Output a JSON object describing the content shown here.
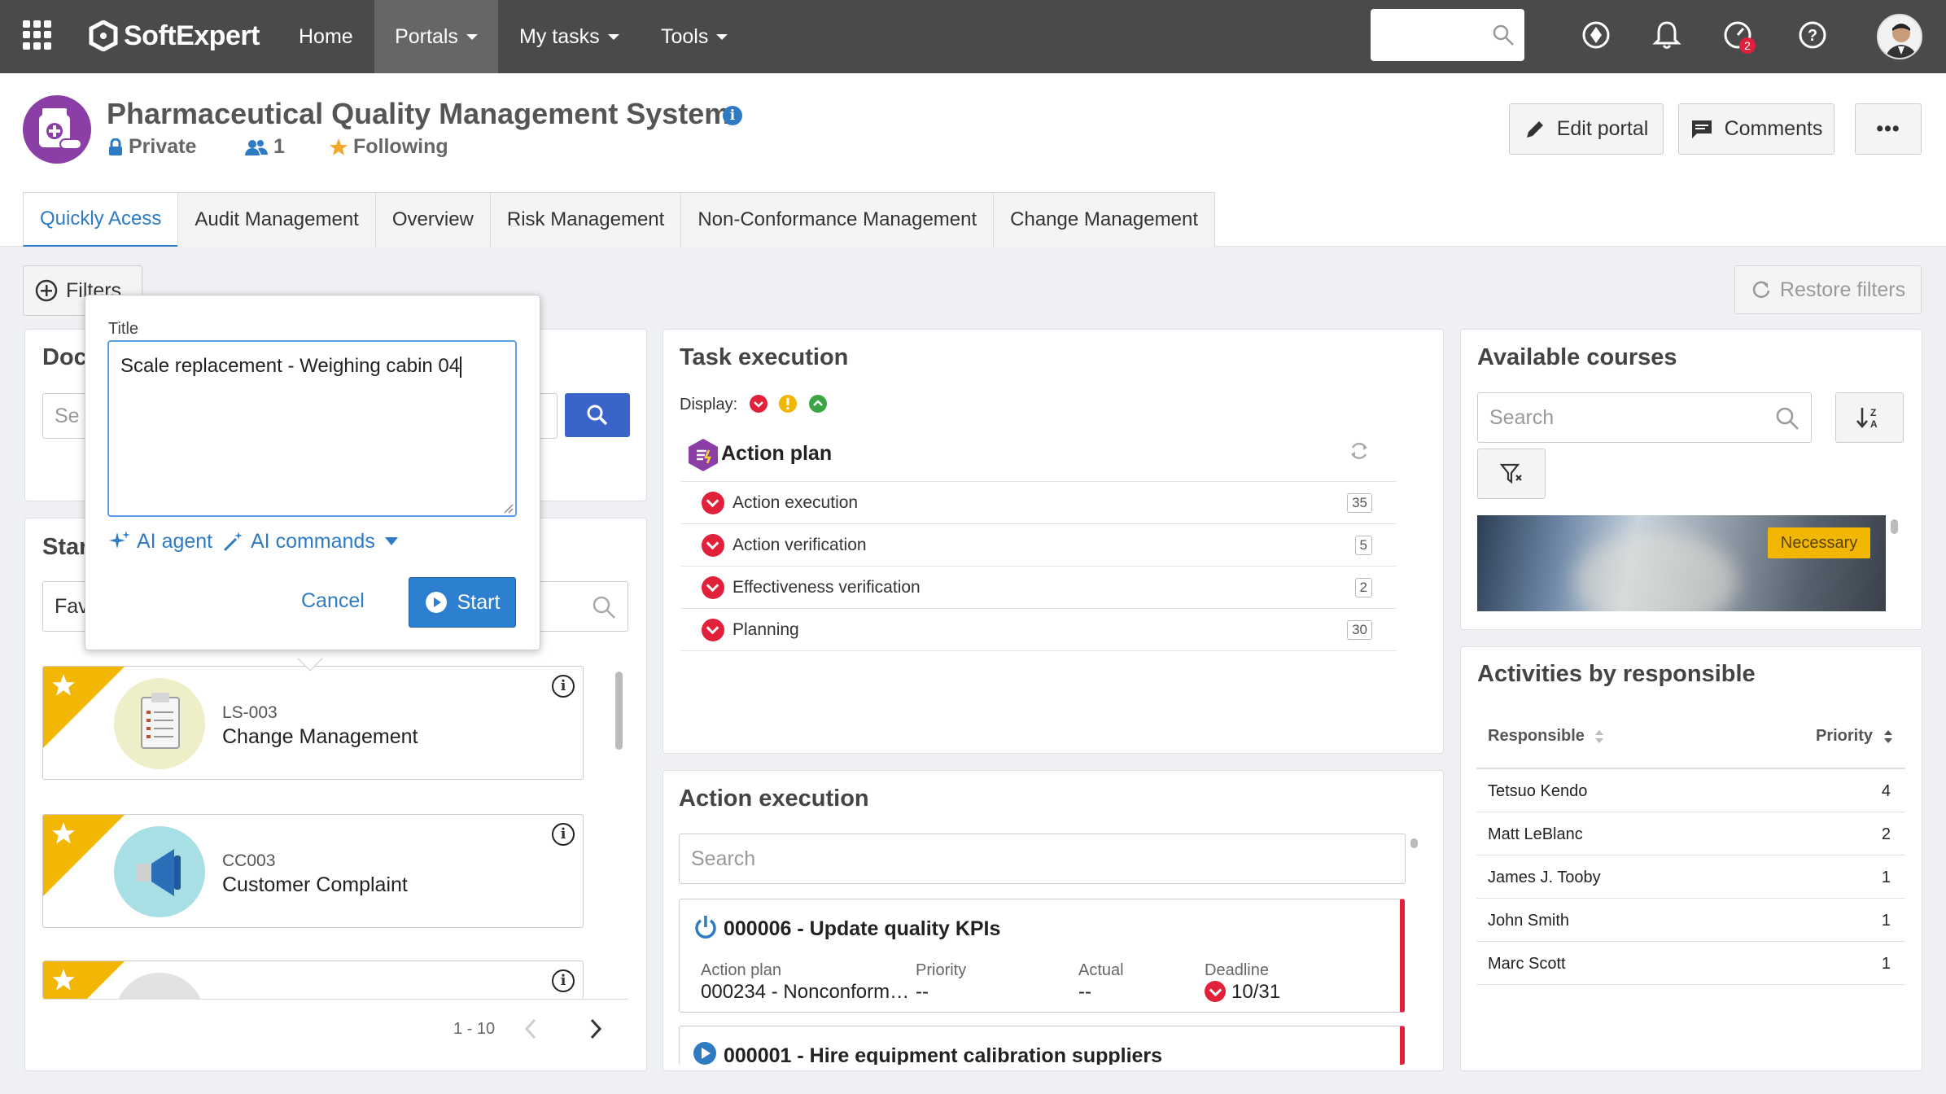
{
  "topbar": {
    "brand": "SoftExpert",
    "nav": {
      "home": "Home",
      "portals": "Portals",
      "my_tasks": "My tasks",
      "tools": "Tools"
    },
    "notification_badge": "2"
  },
  "portal": {
    "title": "Pharmaceutical Quality Management System",
    "privacy": "Private",
    "members": "1",
    "following": "Following",
    "edit_label": "Edit portal",
    "comments_label": "Comments",
    "more_label": "•••"
  },
  "tabs": [
    {
      "label": "Quickly Acess"
    },
    {
      "label": "Audit Management"
    },
    {
      "label": "Overview"
    },
    {
      "label": "Risk Management"
    },
    {
      "label": "Non-Conformance Management"
    },
    {
      "label": "Change Management"
    }
  ],
  "filters": {
    "label": "Filters",
    "restore_label": "Restore filters"
  },
  "documents": {
    "title_visible": "Doc",
    "search_placeholder_visible": "Se"
  },
  "started": {
    "title_visible": "Star",
    "filter_visible": "Fav",
    "items": [
      {
        "code": "LS-003",
        "name": "Change Management"
      },
      {
        "code": "CC003",
        "name": "Customer Complaint"
      }
    ],
    "pager": "1 - 10"
  },
  "task_execution": {
    "title": "Task execution",
    "display_label": "Display:",
    "group": "Action plan",
    "rows": [
      {
        "label": "Action execution",
        "count": "35"
      },
      {
        "label": "Action verification",
        "count": "5"
      },
      {
        "label": "Effectiveness verification",
        "count": "2"
      },
      {
        "label": "Planning",
        "count": "30"
      }
    ]
  },
  "action_execution": {
    "title": "Action execution",
    "search_placeholder": "Search",
    "cards": [
      {
        "title": "000006 - Update quality KPIs",
        "plan_label": "Action plan",
        "plan_value": "000234 - Nonconform…",
        "priority_label": "Priority",
        "priority_value": "--",
        "actual_label": "Actual",
        "actual_value": "--",
        "deadline_label": "Deadline",
        "deadline_value": "10/31"
      },
      {
        "title": "000001 - Hire equipment calibration suppliers"
      }
    ]
  },
  "courses": {
    "title": "Available courses",
    "search_placeholder": "Search",
    "badge": "Necessary"
  },
  "activities": {
    "title": "Activities by responsible",
    "col_responsible": "Responsible",
    "col_priority": "Priority",
    "rows": [
      {
        "name": "Tetsuo Kendo",
        "value": "4"
      },
      {
        "name": "Matt LeBlanc",
        "value": "2"
      },
      {
        "name": "James J. Tooby",
        "value": "1"
      },
      {
        "name": "John Smith",
        "value": "1"
      },
      {
        "name": "Marc Scott",
        "value": "1"
      }
    ]
  },
  "popup": {
    "title_label": "Title",
    "title_value": "Scale replacement - Weighing cabin 04",
    "ai_agent": "AI agent",
    "ai_commands": "AI commands",
    "cancel": "Cancel",
    "start": "Start"
  },
  "colors": {
    "topbar": "#4a4a4a",
    "accent_blue": "#2e7bc4",
    "favorite_yellow": "#f2b705",
    "alert_red": "#e1203a"
  }
}
